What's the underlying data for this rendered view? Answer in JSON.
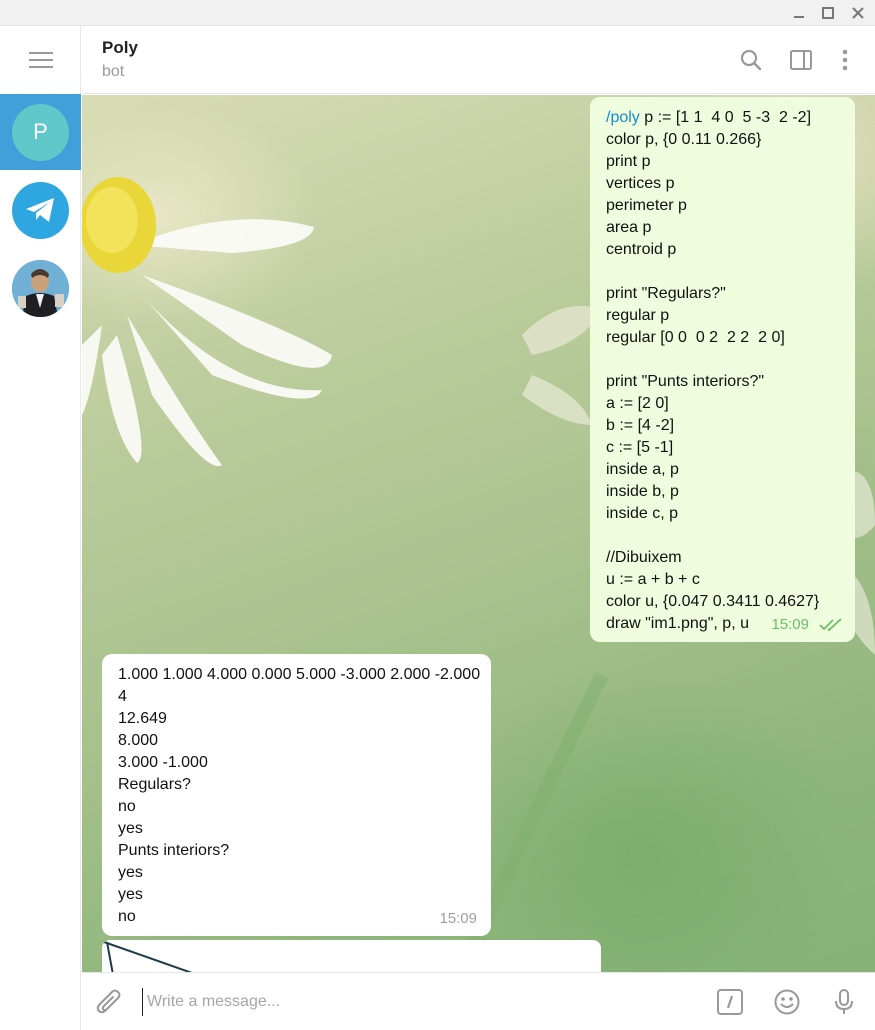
{
  "window": {
    "controls": [
      "minimize-icon",
      "maximize-icon",
      "close-icon"
    ]
  },
  "sidebar": {
    "chats": [
      {
        "initial": "P",
        "icon": "avatar-letter",
        "active": true
      },
      {
        "icon": "telegram-icon",
        "active": false
      },
      {
        "icon": "user-photo-avatar",
        "active": false
      }
    ]
  },
  "header": {
    "name": "Poly",
    "status": "bot",
    "icons": [
      "search-icon",
      "sidebar-toggle-icon",
      "more-vertical-icon"
    ]
  },
  "messages": {
    "outgoing": {
      "command": "/poly",
      "first_rest": " p := [1 1  4 0  5 -3  2 -2]",
      "lines": [
        "color p, {0 0.11 0.266}",
        "print p",
        "vertices p",
        "perimeter p",
        "area p",
        "centroid p",
        "",
        "print \"Regulars?\"",
        "regular p",
        "regular [0 0  0 2  2 2  2 0]",
        "",
        "print \"Punts interiors?\"",
        "a := [2 0]",
        "b := [4 -2]",
        "c := [5 -1]",
        "inside a, p",
        "inside b, p",
        "inside c, p",
        "",
        "//Dibuixem",
        "u := a + b + c",
        "color u, {0.047 0.3411 0.4627}",
        "draw \"im1.png\", p, u"
      ],
      "time": "15:09",
      "status_icon": "double-check-icon"
    },
    "incoming": {
      "lines": [
        "1.000 1.000 4.000 0.000 5.000 -3.000 2.000 -2.000",
        "4",
        "12.649",
        "8.000",
        "3.000 -1.000",
        "Regulars?",
        "no",
        "yes",
        "Punts interiors?",
        "yes",
        "yes",
        "no"
      ],
      "time": "15:09"
    }
  },
  "composer": {
    "placeholder": "Write a message...",
    "value": "",
    "icons": [
      "paperclip-icon",
      "bot-command-icon",
      "emoji-icon",
      "microphone-icon"
    ]
  },
  "colors": {
    "accent": "#419fd9",
    "outgoing_bubble": "#effdde",
    "incoming_bubble": "#ffffff",
    "link": "#168acd",
    "check": "#6cbe6a"
  }
}
